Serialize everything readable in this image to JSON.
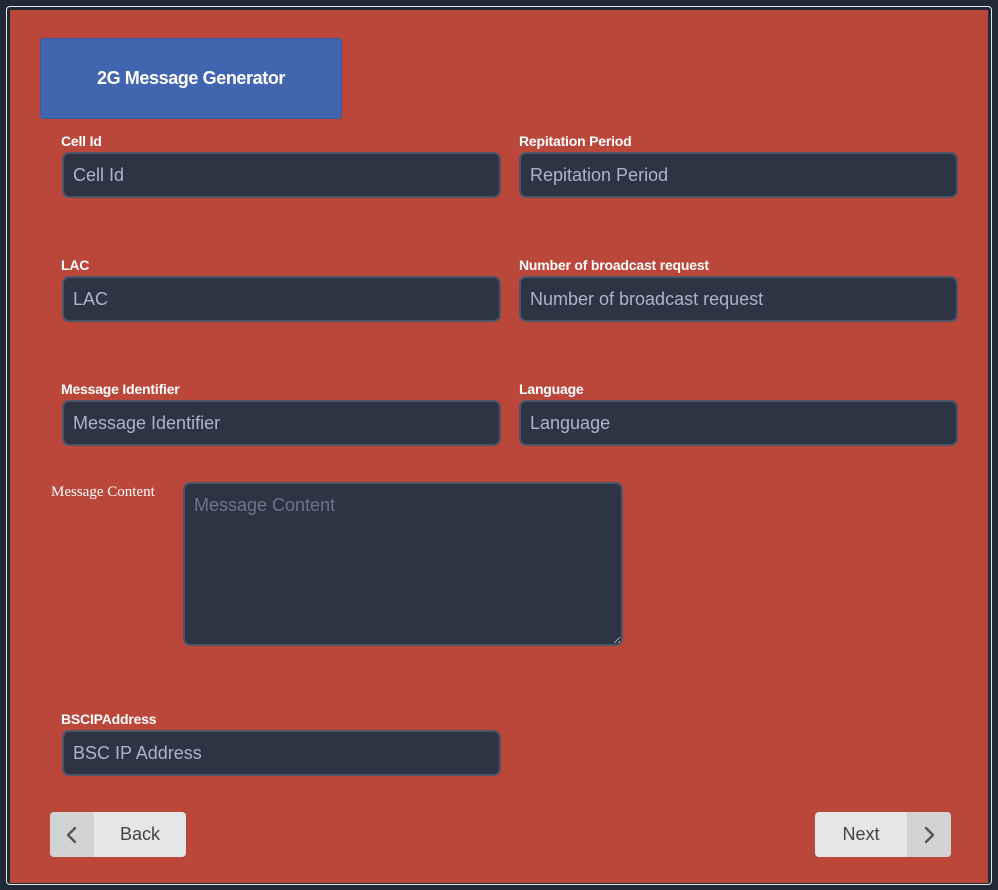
{
  "header": {
    "title": "2G Message Generator"
  },
  "fields": {
    "cell_id": {
      "label": "Cell Id",
      "placeholder": "Cell Id",
      "value": ""
    },
    "repitation_period": {
      "label": "Repitation Period",
      "placeholder": "Repitation Period",
      "value": ""
    },
    "lac": {
      "label": "LAC",
      "placeholder": "LAC",
      "value": ""
    },
    "num_broadcast": {
      "label": "Number of broadcast request",
      "placeholder": "Number of broadcast request",
      "value": ""
    },
    "message_identifier": {
      "label": "Message Identifier",
      "placeholder": "Message Identifier",
      "value": ""
    },
    "language": {
      "label": "Language",
      "placeholder": "Language",
      "value": ""
    },
    "message_content": {
      "label": "Message Content",
      "placeholder": "Message Content",
      "value": ""
    },
    "bsc_ip": {
      "label": "BSCIPAddress",
      "placeholder": "BSC IP Address",
      "value": ""
    }
  },
  "buttons": {
    "back": {
      "label": "Back",
      "icon": "chevron-left-icon"
    },
    "next": {
      "label": "Next",
      "icon": "chevron-right-icon"
    }
  },
  "colors": {
    "panel": "#bb473a",
    "title_button": "#4265b0",
    "field_bg": "#2d3545",
    "page_bg": "#202a36"
  }
}
